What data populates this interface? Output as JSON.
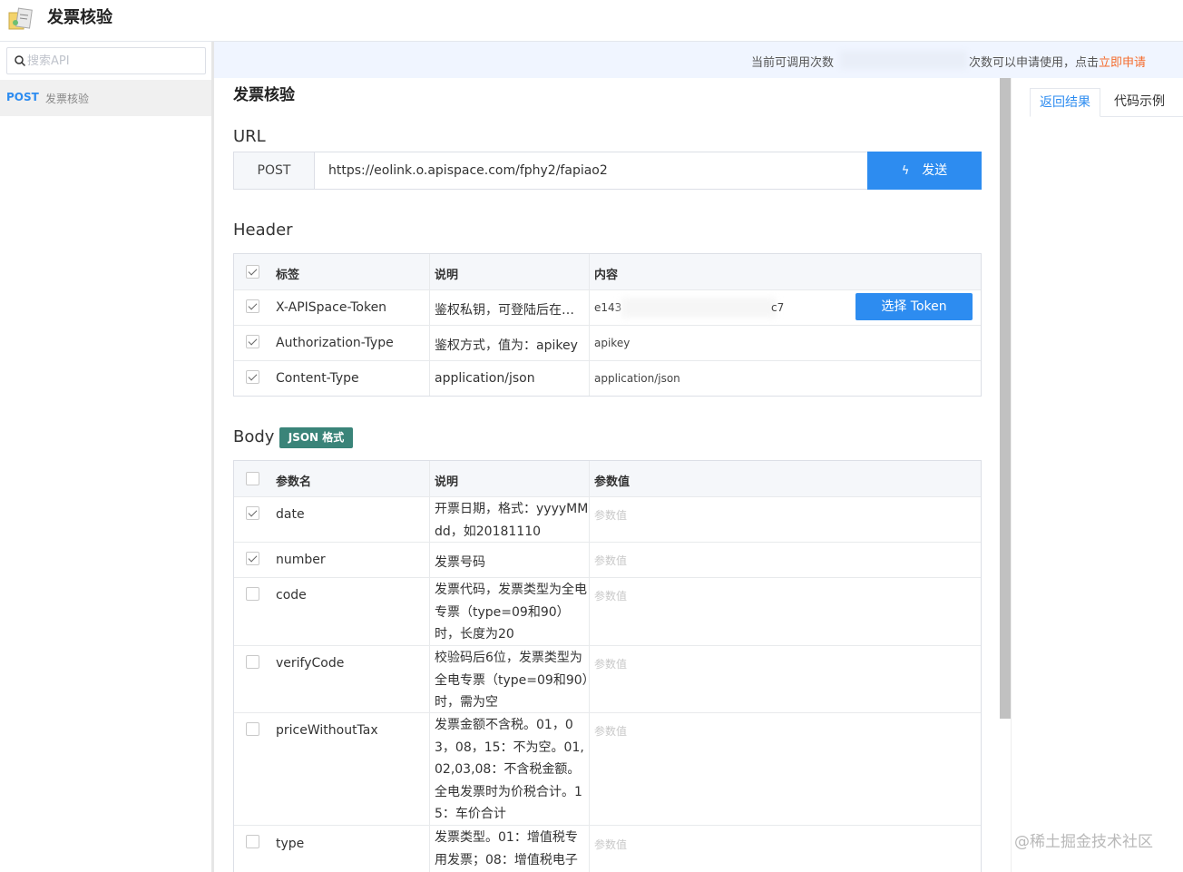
{
  "app": {
    "title": "发票核验"
  },
  "search": {
    "placeholder": "搜索API",
    "value": ""
  },
  "sidebar": {
    "items": [
      {
        "method": "POST",
        "label": "发票核验"
      }
    ]
  },
  "notice": {
    "prefix": "当前可调用次数",
    "suffix": "次数可以申请使用，点击",
    "link": "立即申请"
  },
  "main": {
    "api_title": "发票核验",
    "url_section": "URL",
    "method": "POST",
    "url": "https://eolink.o.apispace.com/fphy2/fapiao2",
    "send_label": "发送",
    "header_section": "Header",
    "body_section": "Body",
    "body_format": "JSON 格式"
  },
  "header_table": {
    "columns": [
      "标签",
      "说明",
      "内容"
    ],
    "rows": [
      {
        "checked": true,
        "name": "X-APISpace-Token",
        "desc": "鉴权私钥，可登陆后在…",
        "value": "e143",
        "value_tail": "c7",
        "action": "选择 Token"
      },
      {
        "checked": true,
        "name": "Authorization-Type",
        "desc": "鉴权方式，值为：apikey",
        "value": "apikey"
      },
      {
        "checked": true,
        "name": "Content-Type",
        "desc": "application/json",
        "value": "application/json"
      }
    ]
  },
  "body_table": {
    "columns": [
      "参数名",
      "说明",
      "参数值"
    ],
    "value_placeholder": "参数值",
    "rows": [
      {
        "checked": true,
        "name": "date",
        "desc": "开票日期，格式：yyyyMMdd，如20181110"
      },
      {
        "checked": true,
        "name": "number",
        "desc": "发票号码"
      },
      {
        "checked": false,
        "name": "code",
        "desc": "发票代码，发票类型为全电专票（type=09和90）时，长度为20"
      },
      {
        "checked": false,
        "name": "verifyCode",
        "desc": "校验码后6位，发票类型为全电专票（type=09和90）时，需为空"
      },
      {
        "checked": false,
        "name": "priceWithoutTax",
        "desc": "发票金额不含税。01，03，08，15：不为空。01,02,03,08：不含税金额。全电发票时为价税合计。15：车价合计"
      },
      {
        "checked": false,
        "name": "type",
        "desc": "发票类型。01：增值税专用发票；08：增值税电子"
      }
    ]
  },
  "right_panel": {
    "tabs": [
      "返回结果",
      "代码示例"
    ],
    "active_tab": 0
  },
  "watermark": "@稀土掘金技术社区",
  "colors": {
    "primary": "#2d8cf0",
    "badge": "#3a8479",
    "link": "#f56c2d"
  }
}
